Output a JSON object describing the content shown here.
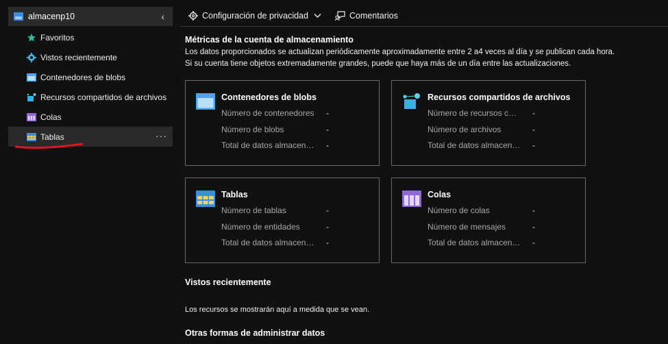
{
  "sidebar": {
    "account": "almacenp10",
    "items": [
      {
        "label": "Favoritos",
        "icon": "star-icon"
      },
      {
        "label": "Vistos recientemente",
        "icon": "gear-icon"
      },
      {
        "label": "Contenedores de blobs",
        "icon": "blob-container-icon"
      },
      {
        "label": "Recursos compartidos de archivos",
        "icon": "file-share-icon"
      },
      {
        "label": "Colas",
        "icon": "queue-icon"
      },
      {
        "label": "Tablas",
        "icon": "table-icon",
        "selected": true
      }
    ],
    "more": "···"
  },
  "toolbar": {
    "privacy": "Configuración de privacidad",
    "feedback": "Comentarios"
  },
  "main": {
    "metrics_title": "Métricas de la cuenta de almacenamiento",
    "desc_line1": "Los datos proporcionados se actualizan periódicamente aproximadamente entre 2 a4 veces al día y se publican cada hora.",
    "desc_line2": "Si su cuenta tiene objetos extremadamente grandes, puede que haya más de un día entre las actualizaciones.",
    "cards": [
      {
        "title": "Contenedores de blobs",
        "icon": "blob-container-icon",
        "rows": [
          {
            "label": "Número de contenedores",
            "value": "-"
          },
          {
            "label": "Número de blobs",
            "value": "-"
          },
          {
            "label": "Total de datos almacenados",
            "value": "-"
          }
        ]
      },
      {
        "title": "Recursos compartidos de archivos",
        "icon": "file-share-icon",
        "rows": [
          {
            "label": "Número de recursos compartidos",
            "value": "-"
          },
          {
            "label": "Número de archivos",
            "value": "-"
          },
          {
            "label": "Total de datos almacenados",
            "value": "-"
          }
        ]
      },
      {
        "title": "Tablas",
        "icon": "table-icon",
        "rows": [
          {
            "label": "Número de tablas",
            "value": "-"
          },
          {
            "label": "Número de entidades",
            "value": "-"
          },
          {
            "label": "Total de datos almacenados",
            "value": "-"
          }
        ]
      },
      {
        "title": "Colas",
        "icon": "queue-icon",
        "rows": [
          {
            "label": "Número de colas",
            "value": "-"
          },
          {
            "label": "Número de mensajes",
            "value": "-"
          },
          {
            "label": "Total de datos almacenados",
            "value": "-"
          }
        ]
      }
    ],
    "recent_title": "Vistos recientemente",
    "recent_text": "Los recursos se mostrarán aquí a medida que se vean.",
    "other_title": "Otras formas de administrar datos"
  },
  "colors": {
    "accent": "#0078d4",
    "annotation": "#e81123"
  }
}
